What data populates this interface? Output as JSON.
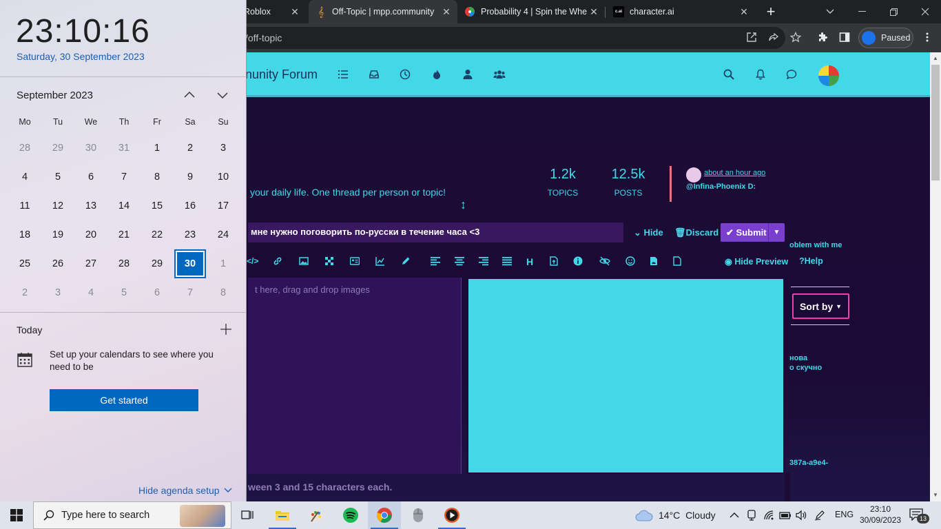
{
  "browser": {
    "tabs": [
      {
        "label": "Roblox",
        "icon": "roblox-icon"
      },
      {
        "label": "Off-Topic | mpp.community",
        "icon": "music-note-icon",
        "active": true
      },
      {
        "label": "Probability 4 | Spin the Whe",
        "icon": "wheel-icon"
      },
      {
        "label": "character.ai",
        "icon": "cai-icon",
        "icon_text": "c.ai"
      }
    ],
    "new_tab": "+",
    "url": "/off-topic",
    "profile_status": "Paused"
  },
  "forum": {
    "title": "nunity Forum",
    "topics_count": "1.2k",
    "topics_label": "TOPICS",
    "posts_count": "12.5k",
    "posts_label": "POSTS",
    "last_post_time": "about an hour ago",
    "last_post_user": "@Infina-Phoenix D:",
    "description": "your daily life. One thread per person or topic!",
    "resize_icon": "↕"
  },
  "composer": {
    "title_value": "мне нужно поговорить по-русски в течение часа <3",
    "hide_label": "Hide",
    "discard_label": "Discard",
    "submit_label": "Submit",
    "editor_placeholder": "t here, drag and drop images",
    "hide_preview_label": "Hide Preview",
    "help_label": "Help",
    "tag_hint": "ween 3 and 15 characters each."
  },
  "sidebar": {
    "problem_text": "oblem with me",
    "sort_label": "Sort by",
    "snippet1": "нова",
    "snippet2": "о скучно",
    "snippet3": "387a-a9e4-"
  },
  "calendar": {
    "time": "23:10:16",
    "date": "Saturday, 30 September 2023",
    "month": "September 2023",
    "weekdays": [
      "Mo",
      "Tu",
      "We",
      "Th",
      "Fr",
      "Sa",
      "Su"
    ],
    "weeks": [
      [
        "28",
        "29",
        "30",
        "31",
        "1",
        "2",
        "3"
      ],
      [
        "4",
        "5",
        "6",
        "7",
        "8",
        "9",
        "10"
      ],
      [
        "11",
        "12",
        "13",
        "14",
        "15",
        "16",
        "17"
      ],
      [
        "18",
        "19",
        "20",
        "21",
        "22",
        "23",
        "24"
      ],
      [
        "25",
        "26",
        "27",
        "28",
        "29",
        "30",
        "1"
      ],
      [
        "2",
        "3",
        "4",
        "5",
        "6",
        "7",
        "8"
      ]
    ],
    "selected_day": "30",
    "today_label": "Today",
    "setup_message": "Set up your calendars to see where you need to be",
    "get_started": "Get started",
    "hide_agenda": "Hide agenda setup"
  },
  "taskbar": {
    "search_placeholder": "Type here to search",
    "apps": [
      "task-view-icon",
      "file-explorer-icon",
      "paint-icon",
      "spotify-icon",
      "chrome-icon",
      "mouse-icon",
      "media-player-icon"
    ],
    "weather_temp": "14°C",
    "weather_desc": "Cloudy",
    "language": "ENG",
    "clock_time": "23:10",
    "clock_date": "30/09/2023",
    "notification_count": "13"
  },
  "colors": {
    "accent_cyan": "#43d8e8",
    "forum_bg": "#1b0c35",
    "submit_purple": "#7b3fd0",
    "sort_pink": "#ec3fb0",
    "windows_blue": "#0067c0"
  }
}
